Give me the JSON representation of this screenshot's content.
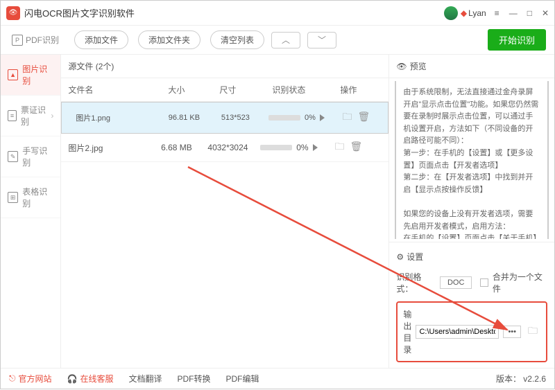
{
  "app": {
    "title": "闪电OCR图片文字识别软件",
    "user": "Lyan"
  },
  "toolbar": {
    "pdf_tab": "PDF识别",
    "add_file": "添加文件",
    "add_folder": "添加文件夹",
    "clear": "清空列表",
    "start": "开始识别"
  },
  "sidebar": {
    "items": [
      {
        "label": "图片识别"
      },
      {
        "label": "票证识别"
      },
      {
        "label": "手写识别"
      },
      {
        "label": "表格识别"
      }
    ]
  },
  "filelist": {
    "heading": "源文件 (2个)",
    "cols": {
      "name": "文件名",
      "size": "大小",
      "dim": "尺寸",
      "status": "识别状态",
      "action": "操作"
    },
    "rows": [
      {
        "name": "图片1.png",
        "size": "96.81 KB",
        "dim": "513*523",
        "pct": "0%"
      },
      {
        "name": "图片2.jpg",
        "size": "6.68 MB",
        "dim": "4032*3024",
        "pct": "0%"
      }
    ]
  },
  "preview": {
    "title": "预览",
    "body": "由于系统限制，无法直接通过金舟录屏开启\"显示点击位置\"功能。如果您仍然需要在录制时展示点击位置，可以通过手机设置开启，方法如下（不同设备的开启路径可能不同）：\n第一步：在手机的【设置】或【更多设置】页面点击【开发者选项】\n第二步：在【开发者选项】中找到并开启【显示点按操作反馈】\n\n如果您的设备上没有开发者选项，需要先启用开发者模式，启用方法：\n在手机的【设置】页面点击【关于手机】或【我的设备】，进入【软件信息】，然后连续点击【版本号】点击5次左右，系统即提示\"您现在处于开发者模式\"。返回【设置】页面后，即可看到【开发者选项】。\n\n注意，【版本号】不是指【Android版本】，不同设备可能不同，例如小米设备上为【MIUI版本】，三星设备上为【编译编号】"
  },
  "settings": {
    "title": "设置",
    "fmt_label": "识别格式：",
    "fmt_value": "DOC",
    "merge": "合并为一个文件",
    "out_label": "输出目录",
    "out_value": "C:\\Users\\admin\\Deskto"
  },
  "footer": {
    "site": "官方网站",
    "cs": "在线客服",
    "doctrans": "文档翻译",
    "pdfconv": "PDF转换",
    "pdfedit": "PDF编辑",
    "ver": "版本： v2.2.6"
  }
}
